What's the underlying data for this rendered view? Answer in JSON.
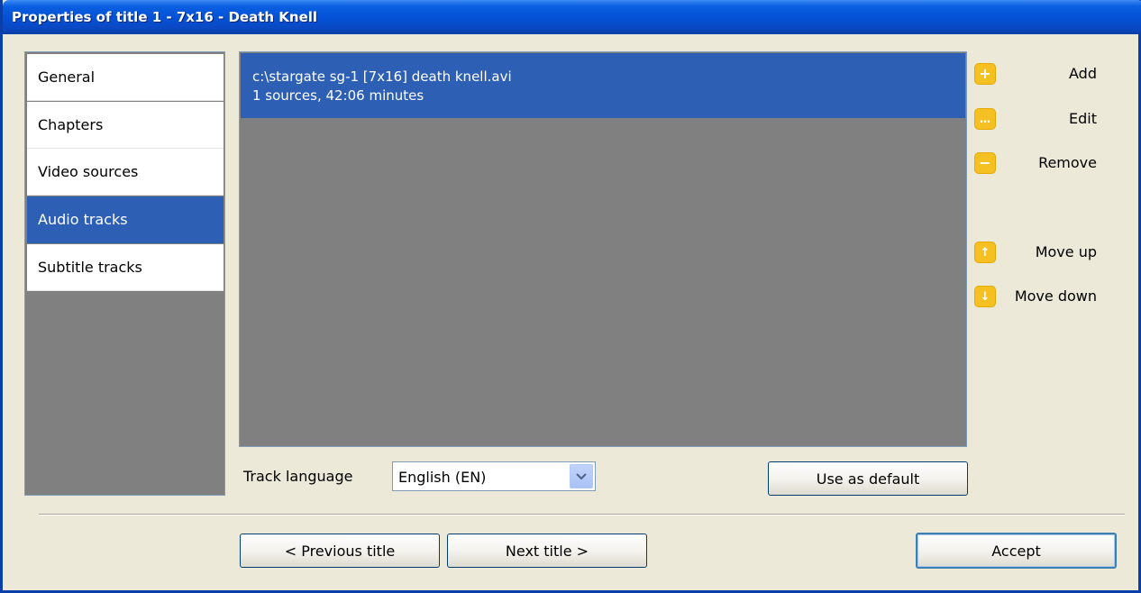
{
  "window": {
    "title": "Properties of title 1 - 7x16 - Death Knell"
  },
  "nav": {
    "items": [
      {
        "label": "General",
        "selected": false
      },
      {
        "label": "Chapters",
        "selected": false
      },
      {
        "label": "Video sources",
        "selected": false
      },
      {
        "label": "Audio tracks",
        "selected": true
      },
      {
        "label": "Subtitle tracks",
        "selected": false
      }
    ]
  },
  "tracks": {
    "items": [
      {
        "line1": "c:\\stargate sg-1 [7x16] death knell.avi",
        "line2": "1 sources, 42:06 minutes",
        "selected": true
      }
    ]
  },
  "actions": {
    "add": {
      "label": "Add",
      "icon": "plus-icon"
    },
    "edit": {
      "label": "Edit",
      "icon": "ellipsis-icon"
    },
    "remove": {
      "label": "Remove",
      "icon": "minus-icon"
    },
    "move_up": {
      "label": "Move up",
      "icon": "arrow-up-icon"
    },
    "move_down": {
      "label": "Move down",
      "icon": "arrow-down-icon"
    }
  },
  "track_language": {
    "label": "Track language",
    "selected": "English (EN)"
  },
  "buttons": {
    "use_as_default": "Use as default",
    "previous_title": "< Previous title",
    "next_title": "Next title >",
    "accept": "Accept"
  },
  "colors": {
    "titlebar": "#0551d6",
    "selection": "#2d5fb5",
    "panel_background": "#ece9d8",
    "list_background": "#808080",
    "action_icon": "#f5c022"
  }
}
